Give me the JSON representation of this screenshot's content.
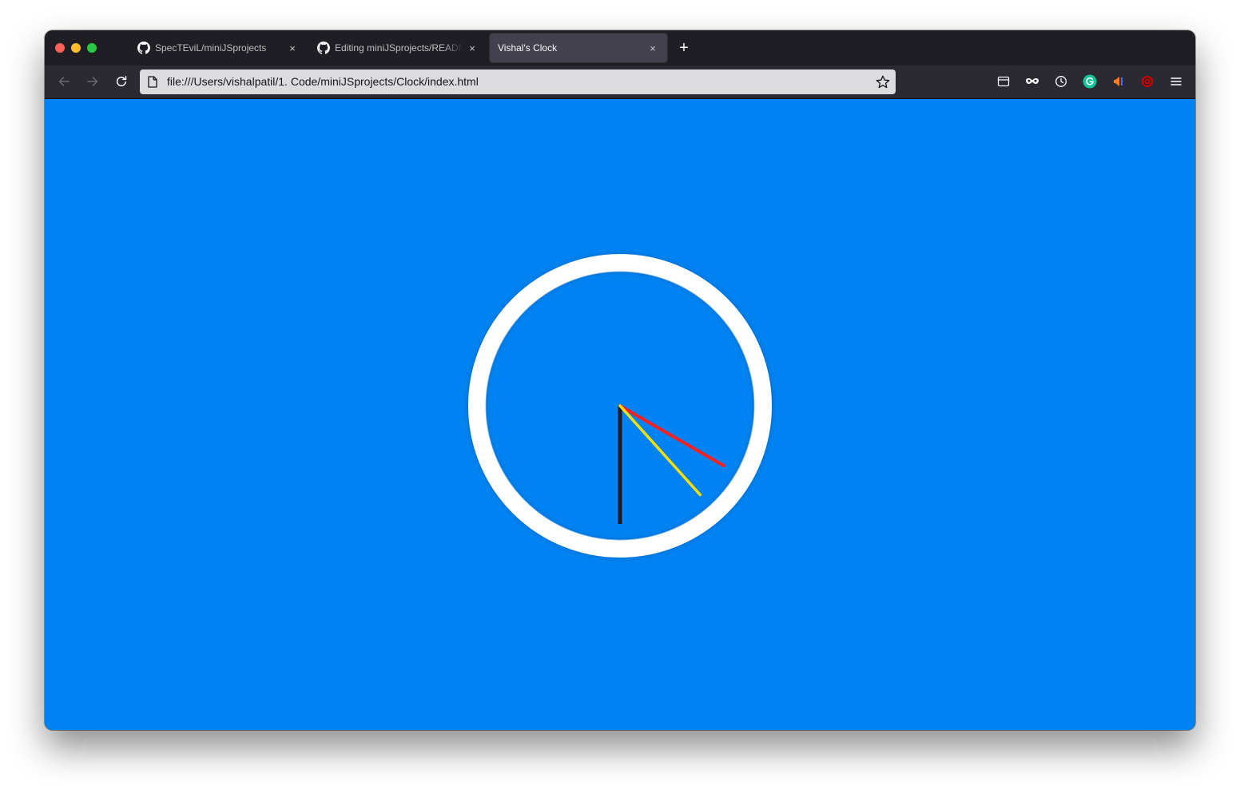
{
  "browser": {
    "tabs": [
      {
        "title": "SpecTEviL/miniJSprojects",
        "icon": "github-icon",
        "active": false
      },
      {
        "title": "Editing miniJSprojects/README",
        "icon": "github-icon",
        "active": false
      },
      {
        "title": "Vishal's Clock",
        "icon": "none",
        "active": true
      }
    ],
    "new_tab_label": "+",
    "close_glyph": "×",
    "url": "file:///Users/vishalpatil/1. Code/miniJSprojects/Clock/index.html",
    "toolbar_icons": [
      "sidebar-icon",
      "private-mask-icon",
      "history-clock-icon",
      "grammarly-icon",
      "extension-icon",
      "extension-red-icon",
      "menu-icon"
    ]
  },
  "clock": {
    "background_color": "#0083f2",
    "face_color": "#ffffff",
    "hands": [
      {
        "name": "hour",
        "color": "#1b1b1b",
        "angle_deg": 180
      },
      {
        "name": "minute",
        "color": "#ff1e1e",
        "angle_deg": 120
      },
      {
        "name": "second",
        "color": "#ffe000",
        "angle_deg": 138
      }
    ]
  }
}
